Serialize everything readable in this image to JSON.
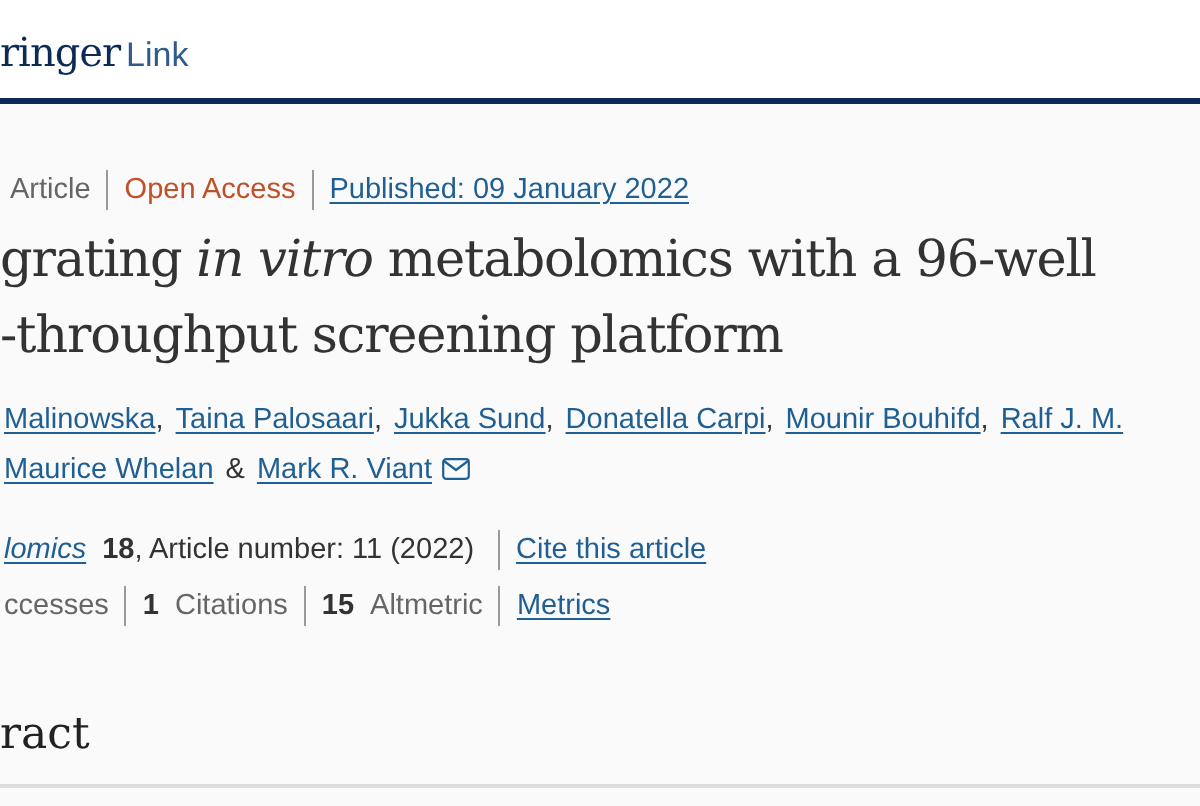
{
  "header": {
    "logo": {
      "brand": "ringer",
      "product": "Link"
    }
  },
  "article": {
    "meta": [
      {
        "kind": "type",
        "text": "Article"
      },
      {
        "kind": "access",
        "text": "Open Access"
      },
      {
        "kind": "link",
        "text": "Published: 09 January 2022"
      }
    ],
    "title": [
      "grating *in vitro* metabolomics with a 96-well",
      "-throughput screening platform"
    ],
    "author_lines": [
      [
        {
          "name": "Malinowska",
          "sep": ","
        },
        {
          "name": "Taina Palosaari",
          "sep": ","
        },
        {
          "name": "Jukka Sund",
          "sep": ","
        },
        {
          "name": "Donatella Carpi",
          "sep": ","
        },
        {
          "name": "Mounir Bouhifd",
          "sep": ","
        },
        {
          "name": "Ralf J. M."
        }
      ],
      [
        {
          "name": "Maurice Whelan",
          "sep": "&"
        },
        {
          "name": "Mark R. Viant",
          "email": true
        }
      ]
    ],
    "citation": {
      "journal": "lomics",
      "details": "**18**, Article number: 11 (2022)",
      "cite_link": "Cite this article"
    },
    "metrics": [
      {
        "label": "ccesses"
      },
      {
        "count": "1",
        "label": "Citations"
      },
      {
        "count": "15",
        "label": "Altmetric"
      }
    ],
    "metrics_link": "Metrics",
    "section_heading": "ract"
  }
}
